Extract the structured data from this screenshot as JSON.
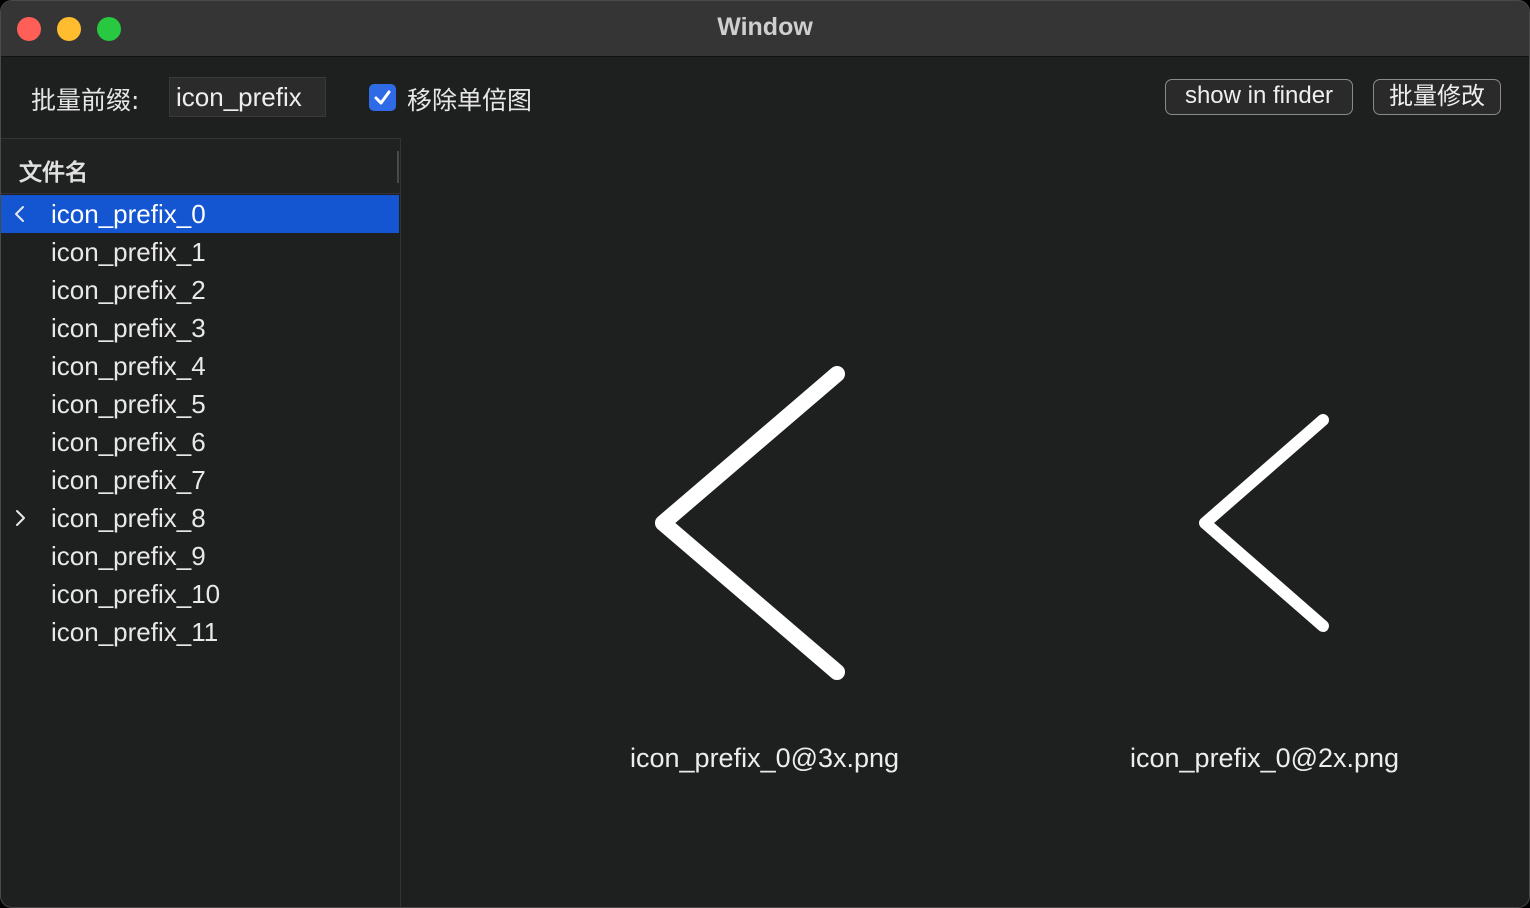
{
  "window": {
    "title": "Window"
  },
  "toolbar": {
    "prefix_label": "批量前缀:",
    "prefix_value": "icon_prefix",
    "checkbox_label": "移除单倍图",
    "checkbox_checked": true,
    "show_in_finder_label": "show in finder",
    "batch_modify_label": "批量修改"
  },
  "list": {
    "header": "文件名",
    "selected_index": 0,
    "items": [
      {
        "label": "icon_prefix_0",
        "chevron": "chevron-left-icon"
      },
      {
        "label": "icon_prefix_1"
      },
      {
        "label": "icon_prefix_2"
      },
      {
        "label": "icon_prefix_3"
      },
      {
        "label": "icon_prefix_4"
      },
      {
        "label": "icon_prefix_5"
      },
      {
        "label": "icon_prefix_6"
      },
      {
        "label": "icon_prefix_7"
      },
      {
        "label": "icon_prefix_8",
        "chevron": "chevron-right-icon"
      },
      {
        "label": "icon_prefix_9"
      },
      {
        "label": "icon_prefix_10"
      },
      {
        "label": "icon_prefix_11"
      }
    ]
  },
  "preview": {
    "items": [
      {
        "filename": "icon_prefix_0@3x.png",
        "icon": "chevron-left-icon"
      },
      {
        "filename": "icon_prefix_0@2x.png",
        "icon": "chevron-left-icon"
      }
    ]
  },
  "colors": {
    "accent": "#1456d1",
    "checkbox": "#2f6be6",
    "background": "#1e1f1f",
    "titlebar": "#353535"
  }
}
